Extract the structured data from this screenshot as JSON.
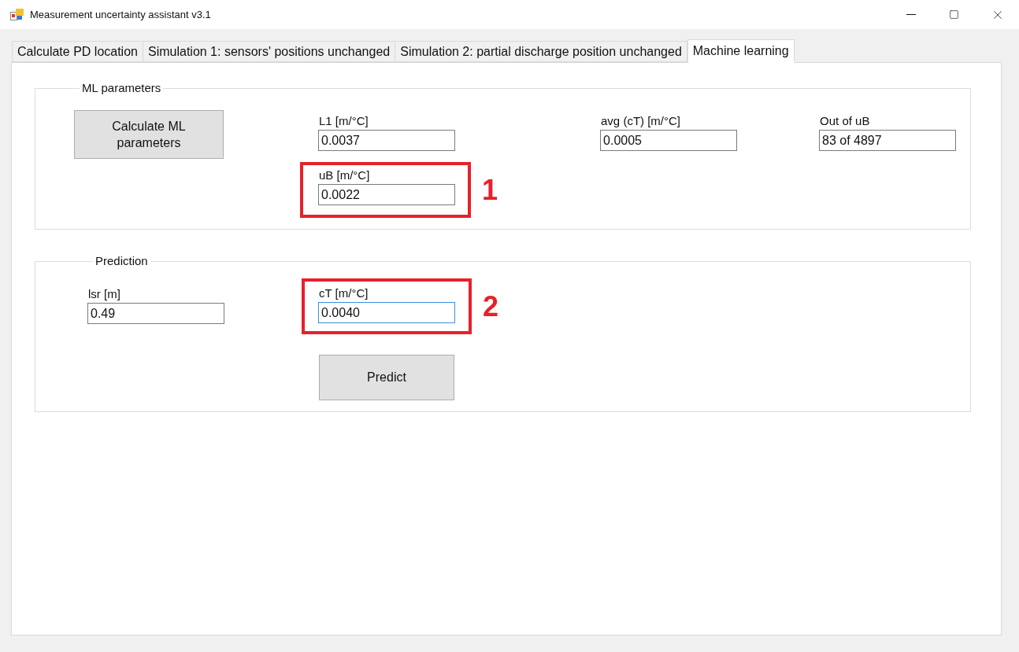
{
  "window": {
    "title": "Measurement uncertainty assistant v3.1"
  },
  "tabs": [
    {
      "label": "Calculate PD location",
      "selected": false
    },
    {
      "label": "Simulation 1: sensors' positions unchanged",
      "selected": false
    },
    {
      "label": "Simulation 2: partial discharge position unchanged",
      "selected": false
    },
    {
      "label": "Machine learning",
      "selected": true
    }
  ],
  "ml_parameters": {
    "title": "ML parameters",
    "button": "Calculate ML parameters",
    "fields": [
      {
        "label": "L1 [m/°C]",
        "value": "0.0037",
        "focused": false
      },
      {
        "label": "avg (cT) [m/°C]",
        "value": "0.0005",
        "focused": false
      },
      {
        "label": "Out of uB",
        "value": "83 of 4897",
        "focused": false
      },
      {
        "label": "uB [m/°C]",
        "value": "0.0022",
        "focused": false,
        "callout": "1"
      }
    ]
  },
  "prediction": {
    "title": "Prediction",
    "button": "Predict",
    "fields": [
      {
        "label": "lsr [m]",
        "value": "0.49",
        "focused": false
      },
      {
        "label": "cT [m/°C]",
        "value": "0.0040",
        "focused": true,
        "callout": "2"
      }
    ]
  }
}
